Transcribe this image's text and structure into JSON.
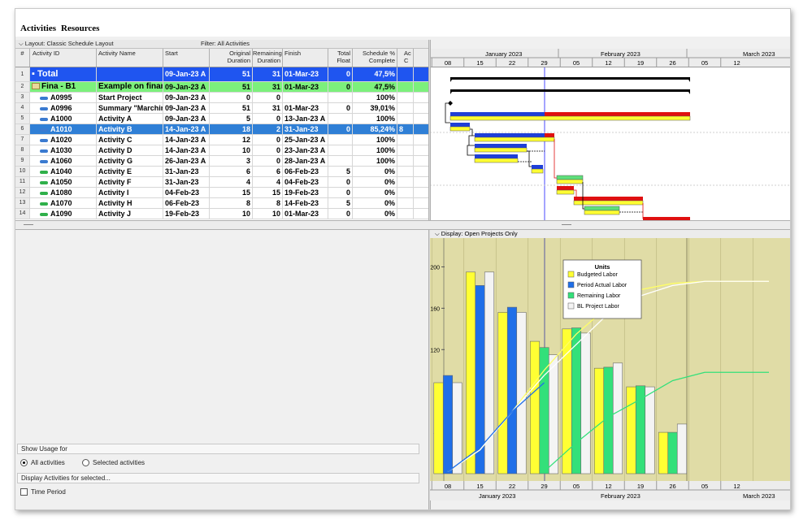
{
  "tabs": [
    "Activities",
    "Resources"
  ],
  "layout_label": "Layout: Classic Schedule Layout",
  "filter_label": "Filter: All Activities",
  "columns": {
    "num": "#",
    "activity_id": "Activity ID",
    "activity_name": "Activity Name",
    "start": "Start",
    "orig_dur_1": "Original",
    "orig_dur_2": "Duration",
    "rem_dur_1": "Remaining",
    "rem_dur_2": "Duration",
    "finish": "Finish",
    "float_1": "Total",
    "float_2": "Float",
    "sched_1": "Schedule %",
    "sched_2": "Complete",
    "ac_1": "Ac",
    "ac_2": "C"
  },
  "rows": [
    {
      "num": "1",
      "id": "Total",
      "name": "",
      "start": "09-Jan-23 A",
      "od": "51",
      "rd": "31",
      "finish": "01-Mar-23",
      "tf": "0",
      "pct": "47,5%",
      "kind": "total"
    },
    {
      "num": "2",
      "id": "Fina - B1",
      "name": "Example on financ",
      "start": "09-Jan-23 A",
      "od": "51",
      "rd": "31",
      "finish": "01-Mar-23",
      "tf": "0",
      "pct": "47,5%",
      "kind": "wbs"
    },
    {
      "num": "3",
      "id": "A0995",
      "name": "Start Project",
      "start": "09-Jan-23 A",
      "od": "0",
      "rd": "0",
      "finish": "",
      "tf": "",
      "pct": "100%",
      "kind": "task"
    },
    {
      "num": "4",
      "id": "A0996",
      "name": "Summary \"Marching",
      "start": "09-Jan-23 A",
      "od": "51",
      "rd": "31",
      "finish": "01-Mar-23",
      "tf": "0",
      "pct": "39,01%",
      "kind": "task"
    },
    {
      "num": "5",
      "id": "A1000",
      "name": "Activity A",
      "start": "09-Jan-23 A",
      "od": "5",
      "rd": "0",
      "finish": "13-Jan-23 A",
      "tf": "",
      "pct": "100%",
      "kind": "task"
    },
    {
      "num": "6",
      "id": "A1010",
      "name": "Activity B",
      "start": "14-Jan-23 A",
      "od": "18",
      "rd": "2",
      "finish": "31-Jan-23",
      "tf": "0",
      "pct": "85,24%",
      "extra": "8",
      "kind": "sel"
    },
    {
      "num": "7",
      "id": "A1020",
      "name": "Activity C",
      "start": "14-Jan-23 A",
      "od": "12",
      "rd": "0",
      "finish": "25-Jan-23 A",
      "tf": "",
      "pct": "100%",
      "kind": "task"
    },
    {
      "num": "8",
      "id": "A1030",
      "name": "Activity D",
      "start": "14-Jan-23 A",
      "od": "10",
      "rd": "0",
      "finish": "23-Jan-23 A",
      "tf": "",
      "pct": "100%",
      "kind": "task"
    },
    {
      "num": "9",
      "id": "A1060",
      "name": "Activity G",
      "start": "26-Jan-23 A",
      "od": "3",
      "rd": "0",
      "finish": "28-Jan-23 A",
      "tf": "",
      "pct": "100%",
      "kind": "task"
    },
    {
      "num": "10",
      "id": "A1040",
      "name": "Activity E",
      "start": "31-Jan-23",
      "od": "6",
      "rd": "6",
      "finish": "06-Feb-23",
      "tf": "5",
      "pct": "0%",
      "kind": "task-green"
    },
    {
      "num": "11",
      "id": "A1050",
      "name": "Activity F",
      "start": "31-Jan-23",
      "od": "4",
      "rd": "4",
      "finish": "04-Feb-23",
      "tf": "0",
      "pct": "0%",
      "kind": "task-green"
    },
    {
      "num": "12",
      "id": "A1080",
      "name": "Activity I",
      "start": "04-Feb-23",
      "od": "15",
      "rd": "15",
      "finish": "19-Feb-23",
      "tf": "0",
      "pct": "0%",
      "kind": "task-green"
    },
    {
      "num": "13",
      "id": "A1070",
      "name": "Activity H",
      "start": "06-Feb-23",
      "od": "8",
      "rd": "8",
      "finish": "14-Feb-23",
      "tf": "5",
      "pct": "0%",
      "kind": "task-green"
    },
    {
      "num": "14",
      "id": "A1090",
      "name": "Activity J",
      "start": "19-Feb-23",
      "od": "10",
      "rd": "10",
      "finish": "01-Mar-23",
      "tf": "0",
      "pct": "0%",
      "kind": "task-green"
    }
  ],
  "timescale": {
    "months": [
      "January 2023",
      "February 2023",
      "March 2023"
    ],
    "weeks": [
      "08",
      "15",
      "22",
      "29",
      "05",
      "12",
      "19",
      "26",
      "05",
      "12"
    ]
  },
  "bottom_panel": {
    "show_usage_for": "Show Usage for",
    "all_activities": "All activities",
    "selected_activities": "Selected activities",
    "display_for_selected": "Display Activities for selected...",
    "time_period": "Time Period"
  },
  "chart_display_label": "Display: Open Projects Only",
  "chart_footer_months": [
    "January 2023",
    "February 2023",
    "March 2023"
  ],
  "colors": {
    "budgeted": "#ffff33",
    "period_actual": "#1f6fe8",
    "remaining": "#33e07a",
    "bl_project": "#f4f4f4",
    "total_row": "#1f55f0",
    "wbs_row": "#7cf07c",
    "selected_row": "#2f7fd6"
  },
  "chart_data": {
    "type": "bar",
    "title": "",
    "legend_title": "Units",
    "legend_position": "top-right",
    "ylim": [
      0,
      220
    ],
    "yticks": [
      40,
      80,
      120,
      160,
      200
    ],
    "categories": [
      "08",
      "15",
      "22",
      "29",
      "05",
      "12",
      "19",
      "26"
    ],
    "series": [
      {
        "name": "Budgeted Labor",
        "values": [
          88,
          195,
          156,
          128,
          140,
          102,
          84,
          40
        ]
      },
      {
        "name": "Period Actual Labor",
        "values": [
          95,
          182,
          161,
          0,
          0,
          0,
          0,
          0
        ]
      },
      {
        "name": "Remaining Labor",
        "values": [
          0,
          0,
          0,
          122,
          141,
          103,
          85,
          40
        ]
      },
      {
        "name": "BL Project Labor",
        "values": [
          88,
          195,
          156,
          115,
          136,
          107,
          84,
          48
        ]
      }
    ],
    "cumulative_lines": [
      {
        "name": "Budgeted Labor",
        "color": "#ffff66",
        "points": [
          [
            0,
            2
          ],
          [
            1,
            23
          ],
          [
            2,
            60
          ],
          [
            3,
            100
          ],
          [
            4,
            135
          ],
          [
            5,
            162
          ],
          [
            6,
            178
          ],
          [
            7,
            184
          ],
          [
            8,
            186
          ],
          [
            9,
            186
          ],
          [
            10,
            186
          ]
        ]
      },
      {
        "name": "BL Project Labor",
        "color": "#ffffff",
        "points": [
          [
            0,
            2
          ],
          [
            1,
            23
          ],
          [
            2,
            60
          ],
          [
            3,
            95
          ],
          [
            4,
            125
          ],
          [
            5,
            155
          ],
          [
            6,
            172
          ],
          [
            7,
            182
          ],
          [
            8,
            186
          ],
          [
            9,
            186
          ],
          [
            10,
            186
          ]
        ]
      },
      {
        "name": "Remaining Labor",
        "color": "#33e07a",
        "points": [
          [
            3,
            2
          ],
          [
            4,
            30
          ],
          [
            5,
            55
          ],
          [
            6,
            72
          ],
          [
            7,
            90
          ],
          [
            8,
            98
          ],
          [
            9,
            98
          ],
          [
            10,
            98
          ]
        ]
      },
      {
        "name": "Period Actual Labor",
        "color": "#1f6fe8",
        "points": [
          [
            0,
            2
          ],
          [
            1,
            25
          ],
          [
            2,
            60
          ],
          [
            3,
            88
          ]
        ]
      }
    ]
  }
}
